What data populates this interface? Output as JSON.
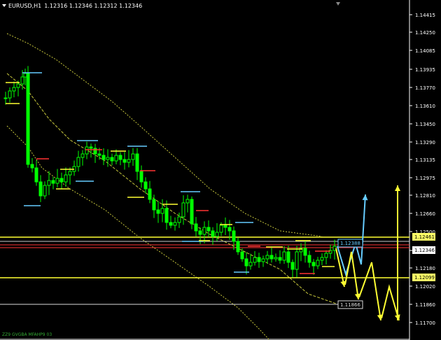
{
  "window": {
    "symbol": "EURUSD,H1",
    "ohlc": "1.12316 1.12346 1.12312 1.12346"
  },
  "footer": "ZZ9 GVGBA MFAHP9 03",
  "price_axis": {
    "labels": [
      "1.14415",
      "1.14250",
      "1.14085",
      "1.13935",
      "1.13770",
      "1.13610",
      "1.13450",
      "1.13290",
      "1.13135",
      "1.12975",
      "1.12810",
      "1.12660",
      "1.12500",
      "1.12346",
      "1.12180",
      "1.12020",
      "1.11860",
      "1.11700"
    ]
  },
  "price_tags": [
    {
      "text": "1.12461",
      "bg": "#ffff66",
      "fg": "#000000",
      "kind": "box"
    },
    {
      "text": "1.12346",
      "bg": "#ffffff",
      "fg": "#000000",
      "kind": "box"
    },
    {
      "text": "1.12099",
      "bg": "#ffff66",
      "fg": "#000000",
      "kind": "box"
    },
    {
      "text": "1.12388",
      "bg": "#000000",
      "fg": "#66ccff",
      "kind": "outline"
    },
    {
      "text": "1.11866",
      "bg": "#000000",
      "fg": "#dddddd",
      "kind": "outline"
    }
  ],
  "colors": {
    "background": "#000000",
    "candles": "#00ff00",
    "yellow": "#ffff33",
    "cyan": "#66ccff",
    "red": "#ff3333",
    "white": "#ffffff",
    "bands": "#c8c83c"
  },
  "chart_data": {
    "type": "candlestick",
    "title": "EURUSD,H1",
    "ylim": [
      1.1163,
      1.1453
    ],
    "current_price": 1.12346
  }
}
